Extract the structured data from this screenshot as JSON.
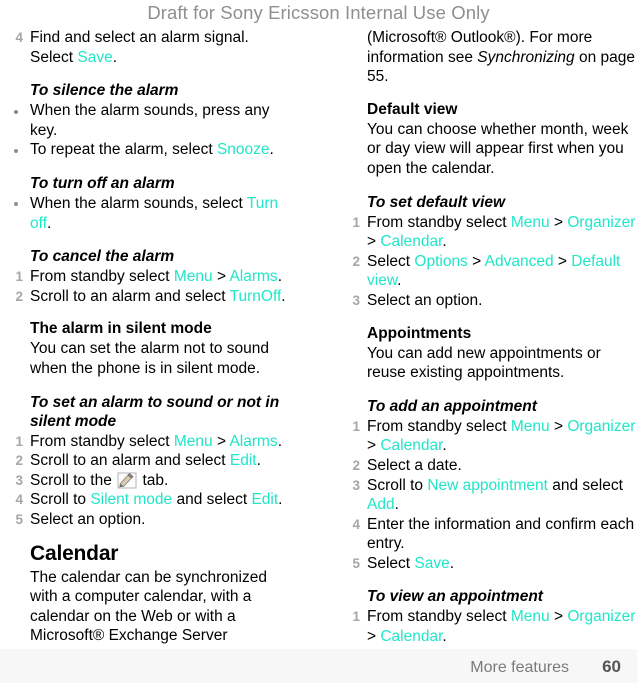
{
  "watermark": "Draft for Sony Ericsson Internal Use Only",
  "accent_color": "#21E6C8",
  "footer": {
    "section": "More features",
    "page_number": "60"
  },
  "left_column": {
    "step4": {
      "num": "4",
      "text_before": "Find and select an alarm signal. Select ",
      "ui": "Save",
      "text_after": "."
    },
    "silence": {
      "heading": "To silence the alarm",
      "bullets": [
        {
          "text_before": "When the alarm sounds, press any key.",
          "ui": "",
          "text_after": ""
        },
        {
          "text_before": "To repeat the alarm, select ",
          "ui": "Snooze",
          "text_after": "."
        }
      ]
    },
    "turn_off": {
      "heading": "To turn off an alarm",
      "bullets": [
        {
          "text_before": "When the alarm sounds, select ",
          "ui": "Turn off",
          "text_after": "."
        }
      ]
    },
    "cancel": {
      "heading": "To cancel the alarm",
      "steps": [
        {
          "num": "1",
          "a": "From standby select ",
          "ui1": "Menu",
          "b": " > ",
          "ui2": "Alarms",
          "c": "."
        },
        {
          "num": "2",
          "a": "Scroll to an alarm and select ",
          "ui1": "TurnOff",
          "b": "",
          "ui2": "",
          "c": "."
        }
      ]
    },
    "silent_mode": {
      "heading": "The alarm in silent mode",
      "body": "You can set the alarm not to sound when the phone is in silent mode."
    },
    "set_silent": {
      "heading": "To set an alarm to sound or not in silent mode",
      "steps": [
        {
          "num": "1",
          "a": "From standby select ",
          "ui1": "Menu",
          "b": " > ",
          "ui2": "Alarms",
          "c": "."
        },
        {
          "num": "2",
          "a": "Scroll to an alarm and select ",
          "ui1": "Edit",
          "b": "",
          "ui2": "",
          "c": "."
        },
        {
          "num": "3",
          "a": "Scroll to the ",
          "icon": "edit-tab-icon",
          "c": " tab."
        },
        {
          "num": "4",
          "a": "Scroll to ",
          "ui1": "Silent mode",
          "b": " and select ",
          "ui2": "Edit",
          "c": "."
        },
        {
          "num": "5",
          "a": "Select an option.",
          "ui1": "",
          "b": "",
          "ui2": "",
          "c": ""
        }
      ]
    },
    "calendar": {
      "heading": "Calendar",
      "body": "The calendar can be synchronized with a computer calendar, with a calendar on the Web or with a Microsoft® Exchange Server"
    }
  },
  "right_column": {
    "calendar_cont": {
      "a": "(Microsoft® Outlook®). For more information see ",
      "italic": "Synchronizing",
      "b": " on page 55."
    },
    "default_view": {
      "heading": "Default view",
      "body": "You can choose whether month, week or day view will appear first when you open the calendar."
    },
    "set_default_view": {
      "heading": "To set default view",
      "steps": [
        {
          "num": "1",
          "a": "From standby select ",
          "ui1": "Menu",
          "b": " > ",
          "ui2": "Organizer",
          "c": " > ",
          "ui3": "Calendar",
          "d": "."
        },
        {
          "num": "2",
          "a": "Select ",
          "ui1": "Options",
          "b": " > ",
          "ui2": "Advanced",
          "c": " > ",
          "ui3": "Default view",
          "d": "."
        },
        {
          "num": "3",
          "a": "Select an option.",
          "ui1": "",
          "b": "",
          "ui2": "",
          "c": "",
          "ui3": "",
          "d": ""
        }
      ]
    },
    "appointments": {
      "heading": "Appointments",
      "body": "You can add new appointments or reuse existing appointments."
    },
    "add_appointment": {
      "heading": "To add an appointment",
      "steps": [
        {
          "num": "1",
          "a": "From standby select ",
          "ui1": "Menu",
          "b": " > ",
          "ui2": "Organizer",
          "c": " > ",
          "ui3": "Calendar",
          "d": "."
        },
        {
          "num": "2",
          "a": "Select a date.",
          "ui1": "",
          "b": "",
          "ui2": "",
          "c": "",
          "ui3": "",
          "d": ""
        },
        {
          "num": "3",
          "a": "Scroll to ",
          "ui1": "New appointment",
          "b": " and select ",
          "ui2": "Add",
          "c": "",
          "ui3": "",
          "d": "."
        },
        {
          "num": "4",
          "a": "Enter the information and confirm each entry.",
          "ui1": "",
          "b": "",
          "ui2": "",
          "c": "",
          "ui3": "",
          "d": ""
        },
        {
          "num": "5",
          "a": "Select ",
          "ui1": "Save",
          "b": "",
          "ui2": "",
          "c": "",
          "ui3": "",
          "d": "."
        }
      ]
    },
    "view_appointment": {
      "heading": "To view an appointment",
      "steps": [
        {
          "num": "1",
          "a": "From standby select ",
          "ui1": "Menu",
          "b": " > ",
          "ui2": "Organizer",
          "c": " > ",
          "ui3": "Calendar",
          "d": "."
        }
      ]
    }
  }
}
